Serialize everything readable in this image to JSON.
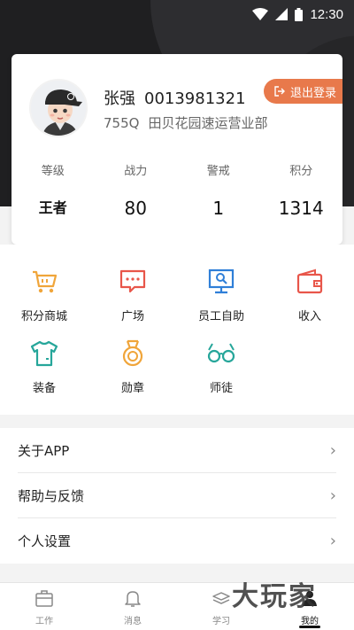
{
  "status_bar": {
    "time": "12:30"
  },
  "profile": {
    "name": "张强",
    "employee_id": "0013981321",
    "site_code": "755Q",
    "branch": "田贝花园速运营业部",
    "logout_label": "退出登录",
    "stats": [
      {
        "label": "等级",
        "value": "王者"
      },
      {
        "label": "战力",
        "value": "80"
      },
      {
        "label": "警戒",
        "value": "1"
      },
      {
        "label": "积分",
        "value": "1314"
      }
    ]
  },
  "grid": [
    {
      "label": "积分商城",
      "icon": "shopping-cart-icon",
      "color": "#f0a53a"
    },
    {
      "label": "广场",
      "icon": "chat-bubble-icon",
      "color": "#e8564a"
    },
    {
      "label": "员工自助",
      "icon": "monitor-search-icon",
      "color": "#2f7fd8"
    },
    {
      "label": "收入",
      "icon": "wallet-icon",
      "color": "#e8564a"
    },
    {
      "label": "装备",
      "icon": "tshirt-icon",
      "color": "#26a69a"
    },
    {
      "label": "勋章",
      "icon": "medal-icon",
      "color": "#f0a53a"
    },
    {
      "label": "师徒",
      "icon": "glasses-icon",
      "color": "#26a69a"
    }
  ],
  "menu": [
    {
      "label": "关于APP"
    },
    {
      "label": "帮助与反馈"
    },
    {
      "label": "个人设置"
    }
  ],
  "tabs": [
    {
      "label": "工作",
      "icon": "briefcase-icon"
    },
    {
      "label": "消息",
      "icon": "bell-icon"
    },
    {
      "label": "学习",
      "icon": "book-icon"
    },
    {
      "label": "我的",
      "icon": "person-icon",
      "active": true
    }
  ],
  "watermark": "大玩家"
}
